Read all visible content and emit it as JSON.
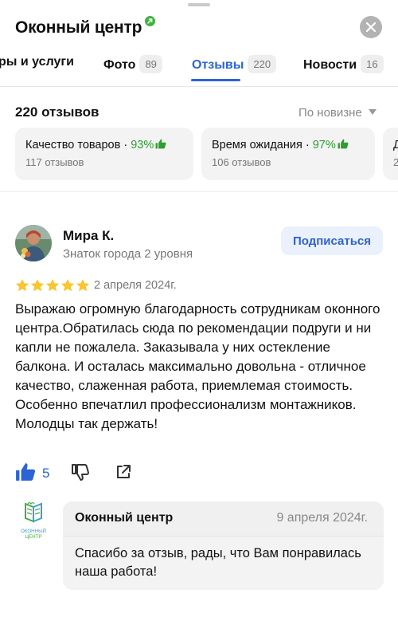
{
  "header": {
    "title": "Оконный центр",
    "verified_icon": "verified-check-icon",
    "close_icon": "close-icon"
  },
  "tabs": [
    {
      "label": "ры и услуги",
      "count": ""
    },
    {
      "label": "Фото",
      "count": "89"
    },
    {
      "label": "Отзывы",
      "count": "220",
      "active": true
    },
    {
      "label": "Новости",
      "count": "16"
    }
  ],
  "summary": {
    "count_label": "220 отзывов",
    "sort_label": "По новизне"
  },
  "aspects": [
    {
      "title": "Качество товаров",
      "separator": " · ",
      "percent": "93%",
      "sub": "117 отзывов"
    },
    {
      "title": "Время ожидания",
      "separator": " · ",
      "percent": "97%",
      "sub": "106 отзывов"
    },
    {
      "title": "Д",
      "separator": "",
      "percent": "",
      "sub": "2"
    }
  ],
  "review": {
    "author": "Мира К.",
    "level": "Знаток города 2 уровня",
    "subscribe_label": "Подписаться",
    "rating": 5,
    "date": "2 апреля 2024г.",
    "text": "Выражаю огромную благодарность сотрудникам оконного центра.Обратилась сюда по рекомендации подруги и ни капли не пожалела. Заказывала у них остекление балкона. И осталась максимально довольна - отличное качество, слаженная работа, приемлемая стоимость. Особенно впечатлил профессионализм монтажников. Молодцы так держать!",
    "likes": "5"
  },
  "reply": {
    "org_name": "Оконный центр",
    "date": "9 апреля 2024г.",
    "text": "Спасибо за отзыв, рады, что Вам понравилась наша работа!",
    "logo_text": "ОКОННЫЙ ЦЕНТР"
  },
  "colors": {
    "accent_blue": "#2c63d6",
    "star_yellow": "#fcc52c",
    "percent_green": "#2e9d32",
    "verified_green": "#3fb43f",
    "logo_green": "#3fb13a",
    "logo_blue": "#3aa0d8"
  }
}
